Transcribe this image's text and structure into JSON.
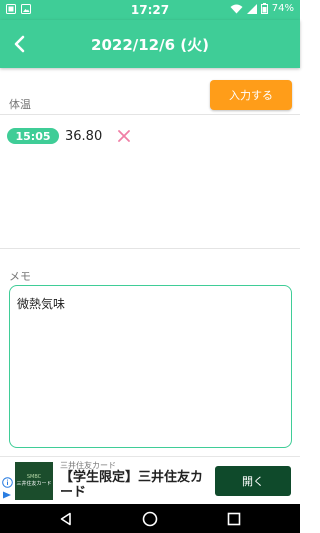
{
  "status_bar": {
    "time": "17:27",
    "battery": "74%"
  },
  "app_bar": {
    "title": "2022/12/6 (火)"
  },
  "temperature": {
    "section_label": "体温",
    "input_button": "入力する",
    "records": [
      {
        "time": "15:05",
        "value": "36.80"
      }
    ]
  },
  "memo": {
    "section_label": "メモ",
    "text": "微熱気味"
  },
  "ad": {
    "logo_brand": "SMBC",
    "logo_text": "三井住友カード",
    "sponsor": "三井住友カード",
    "headline": "【学生限定】三井住友カード",
    "cta": "開く"
  },
  "colors": {
    "primary": "#3fcd97",
    "accent": "#ff9d19",
    "delete": "#f07fa6",
    "ad_green": "#0f4a2b"
  }
}
